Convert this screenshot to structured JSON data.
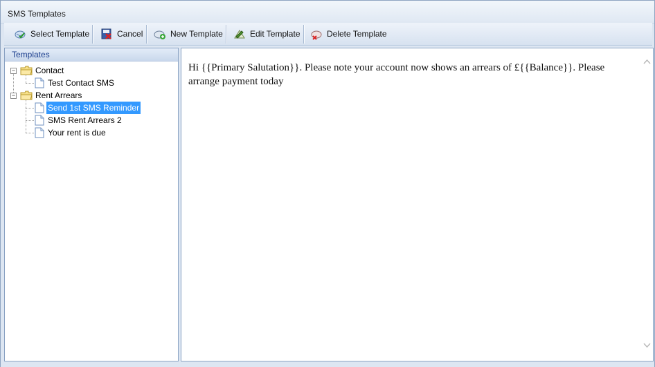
{
  "window": {
    "title": "SMS Templates"
  },
  "toolbar": {
    "buttons": [
      {
        "label": "Select Template",
        "icon": "select-template-icon"
      },
      {
        "label": "Cancel",
        "icon": "cancel-icon"
      },
      {
        "label": "New Template",
        "icon": "new-template-icon"
      },
      {
        "label": "Edit Template",
        "icon": "edit-template-icon"
      },
      {
        "label": "Delete Template",
        "icon": "delete-template-icon"
      }
    ]
  },
  "tree": {
    "header": "Templates",
    "nodes": [
      {
        "label": "Contact",
        "type": "folder",
        "expanded": true,
        "children": [
          {
            "label": "Test Contact SMS"
          }
        ]
      },
      {
        "label": "Rent Arrears",
        "type": "folder",
        "expanded": true,
        "children": [
          {
            "label": "Send 1st SMS Reminder",
            "selected": true
          },
          {
            "label": "SMS Rent Arrears 2"
          },
          {
            "label": "Your rent is due"
          }
        ]
      }
    ]
  },
  "preview": {
    "text": "Hi {{Primary Salutation}}. Please note your account now shows an arrears of £{{Balance}}. Please arrange payment today"
  },
  "colors": {
    "selection": "#3399ff",
    "header_text": "#1c3f8e"
  }
}
